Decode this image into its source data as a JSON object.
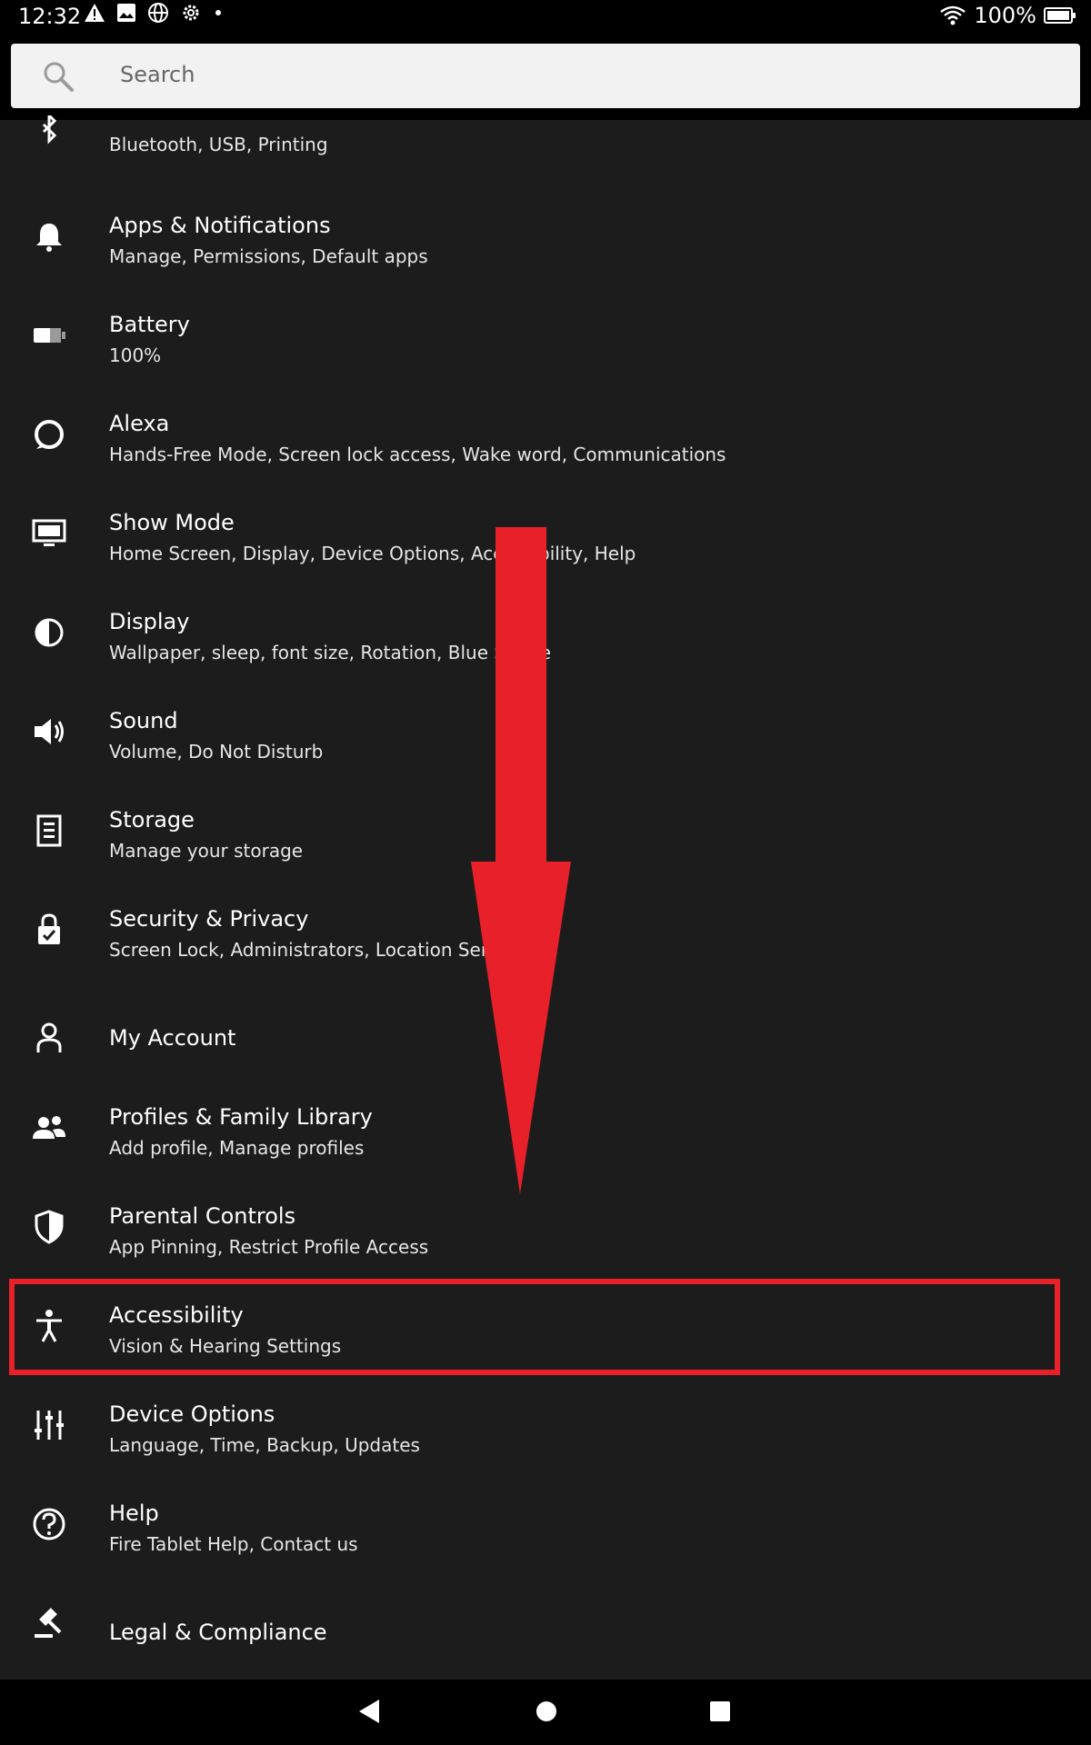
{
  "status_bar": {
    "time": "12:32",
    "battery_text": "100%",
    "icons": [
      "warning-icon",
      "image-icon",
      "globe-icon",
      "gear-icon",
      "dot-icon"
    ],
    "right_icons": [
      "wifi-icon",
      "battery-icon"
    ]
  },
  "search": {
    "placeholder": "Search"
  },
  "settings": [
    {
      "id": "connected-devices",
      "icon": "bluetooth-icon",
      "title": "",
      "subtitle": "Bluetooth, USB, Printing"
    },
    {
      "id": "apps-notifications",
      "icon": "bell-icon",
      "title": "Apps & Notifications",
      "subtitle": "Manage, Permissions, Default apps"
    },
    {
      "id": "battery",
      "icon": "battery-icon",
      "title": "Battery",
      "subtitle": "100%"
    },
    {
      "id": "alexa",
      "icon": "alexa-ring-icon",
      "title": "Alexa",
      "subtitle": "Hands-Free Mode, Screen lock access, Wake word, Communications"
    },
    {
      "id": "show-mode",
      "icon": "monitor-icon",
      "title": "Show Mode",
      "subtitle": "Home Screen, Display, Device Options, Accessibility, Help"
    },
    {
      "id": "display",
      "icon": "half-circle-icon",
      "title": "Display",
      "subtitle": "Wallpaper, sleep, font size, Rotation, Blue Shade"
    },
    {
      "id": "sound",
      "icon": "speaker-icon",
      "title": "Sound",
      "subtitle": "Volume, Do Not Disturb"
    },
    {
      "id": "storage",
      "icon": "storage-icon",
      "title": "Storage",
      "subtitle": "Manage your storage"
    },
    {
      "id": "security-privacy",
      "icon": "lock-check-icon",
      "title": "Security & Privacy",
      "subtitle": "Screen Lock, Administrators, Location Services"
    },
    {
      "id": "my-account",
      "icon": "person-icon",
      "title": "My Account",
      "subtitle": ""
    },
    {
      "id": "profiles-family",
      "icon": "people-icon",
      "title": "Profiles & Family Library",
      "subtitle": "Add profile, Manage profiles"
    },
    {
      "id": "parental-controls",
      "icon": "shield-icon",
      "title": "Parental Controls",
      "subtitle": "App Pinning, Restrict Profile Access"
    },
    {
      "id": "accessibility",
      "icon": "accessibility-icon",
      "title": "Accessibility",
      "subtitle": "Vision & Hearing Settings"
    },
    {
      "id": "device-options",
      "icon": "sliders-icon",
      "title": "Device Options",
      "subtitle": "Language, Time, Backup, Updates"
    },
    {
      "id": "help",
      "icon": "help-icon",
      "title": "Help",
      "subtitle": "Fire Tablet Help, Contact us"
    },
    {
      "id": "legal",
      "icon": "gavel-icon",
      "title": "Legal & Compliance",
      "subtitle": ""
    }
  ],
  "navigation": {
    "icons": [
      "back-icon",
      "home-icon",
      "recents-icon"
    ]
  },
  "annotation": {
    "color": "#e8202a",
    "highlighted": "accessibility"
  }
}
